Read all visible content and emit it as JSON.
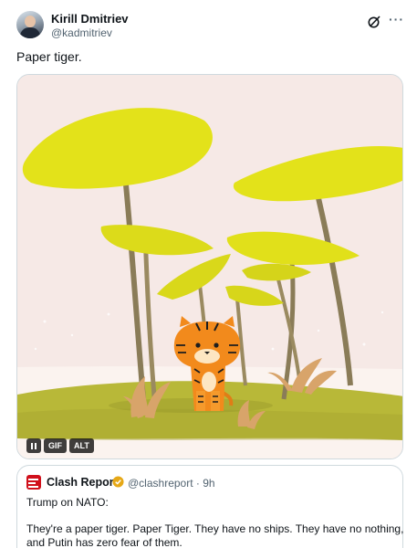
{
  "author": {
    "name": "Kirill Dmitriev",
    "handle": "@kadmitriev"
  },
  "post_text": "Paper tiger.",
  "media": {
    "controls": {
      "pause_icon": "pause-icon",
      "gif_label": "GIF",
      "alt_label": "ALT"
    },
    "colors": {
      "background": "#f6e9e6",
      "leaf": "#e3e21a",
      "ground": "#b9b83a",
      "tiger": "#f28a1c"
    }
  },
  "quote": {
    "name": "Clash Report",
    "handle_time": "@clashreport · 9h",
    "line1": "Trump on NATO:",
    "line2": "They're a paper tiger. Paper Tiger. They have no ships. They have no nothing,",
    "line3": "and Putin has zero fear of them."
  },
  "colors": {
    "text": "#0f1419",
    "secondary": "#536471",
    "border": "#cfd9de",
    "verified": "#e6a817",
    "brand_red": "#d0101b"
  }
}
